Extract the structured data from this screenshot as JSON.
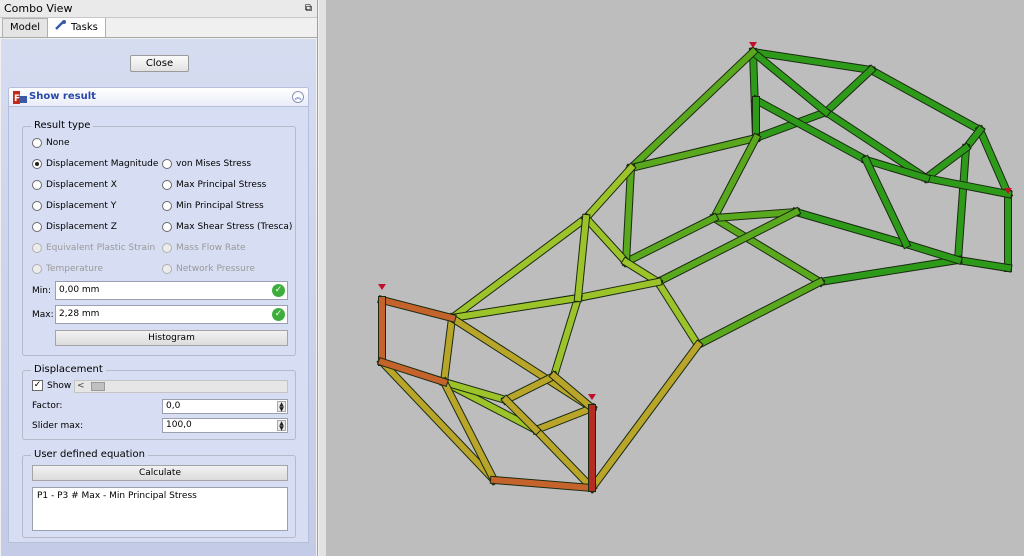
{
  "combo_view": {
    "title": "Combo View",
    "tabs": [
      {
        "label": "Model"
      },
      {
        "label": "Tasks"
      }
    ]
  },
  "tasks": {
    "close_label": "Close",
    "taskbox_title": "Show result",
    "result_type": {
      "group_title": "Result type",
      "options": [
        {
          "label": "None",
          "checked": false,
          "enabled": true
        },
        {
          "label": "Displacement Magnitude",
          "checked": true,
          "enabled": true
        },
        {
          "label": "Displacement X",
          "checked": false,
          "enabled": true
        },
        {
          "label": "Displacement Y",
          "checked": false,
          "enabled": true
        },
        {
          "label": "Displacement Z",
          "checked": false,
          "enabled": true
        },
        {
          "label": "Equivalent Plastic Strain",
          "checked": false,
          "enabled": false
        },
        {
          "label": "Temperature",
          "checked": false,
          "enabled": false
        },
        {
          "label": "von Mises Stress",
          "checked": false,
          "enabled": true
        },
        {
          "label": "Max Principal Stress",
          "checked": false,
          "enabled": true
        },
        {
          "label": "Min Principal Stress",
          "checked": false,
          "enabled": true
        },
        {
          "label": "Max Shear Stress (Tresca)",
          "checked": false,
          "enabled": true
        },
        {
          "label": "Mass Flow Rate",
          "checked": false,
          "enabled": false
        },
        {
          "label": "Network Pressure",
          "checked": false,
          "enabled": false
        }
      ],
      "min_label": "Min:",
      "min_value": "0,00 mm",
      "max_label": "Max:",
      "max_value": "2,28 mm",
      "histogram_label": "Histogram"
    },
    "displacement": {
      "group_title": "Displacement",
      "show_label": "Show",
      "show_checked": true,
      "slider_position": 0,
      "factor_label": "Factor:",
      "factor_value": "0,0",
      "slider_max_label": "Slider max:",
      "slider_max_value": "100,0"
    },
    "equation": {
      "group_title": "User defined equation",
      "calculate_label": "Calculate",
      "text": "P1 - P3 # Max - Min Principal Stress"
    }
  },
  "viewport": {
    "background": "#bdbdbd",
    "colors": {
      "low": "#2e9a1a",
      "mid_low": "#5aa81e",
      "mid": "#9cc42a",
      "mid_high": "#b9a52a",
      "high": "#c4642c",
      "max": "#b52d22",
      "marker": "#c0102a"
    }
  }
}
